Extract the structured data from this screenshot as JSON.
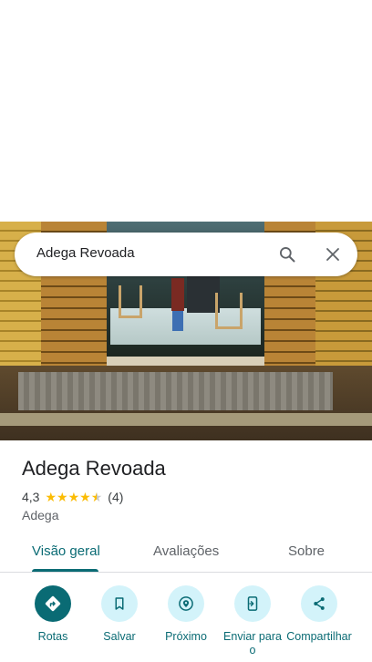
{
  "search": {
    "query": "Adega Revoada"
  },
  "place": {
    "name": "Adega Revoada",
    "rating": "4,3",
    "rating_value": 4.3,
    "review_count": "(4)",
    "category": "Adega"
  },
  "tabs": [
    {
      "label": "Visão geral",
      "active": true
    },
    {
      "label": "Avaliações",
      "active": false
    },
    {
      "label": "Sobre",
      "active": false
    }
  ],
  "actions": [
    {
      "label": "Rotas",
      "icon": "directions-icon"
    },
    {
      "label": "Salvar",
      "icon": "bookmark-icon"
    },
    {
      "label": "Próximo",
      "icon": "nearby-icon"
    },
    {
      "label": "Enviar para o",
      "icon": "send-to-phone-icon"
    },
    {
      "label": "Compartilhar",
      "icon": "share-icon"
    }
  ],
  "colors": {
    "accent": "#0a6b74",
    "action_bg": "#d3f3fa",
    "star": "#fbbc04"
  }
}
